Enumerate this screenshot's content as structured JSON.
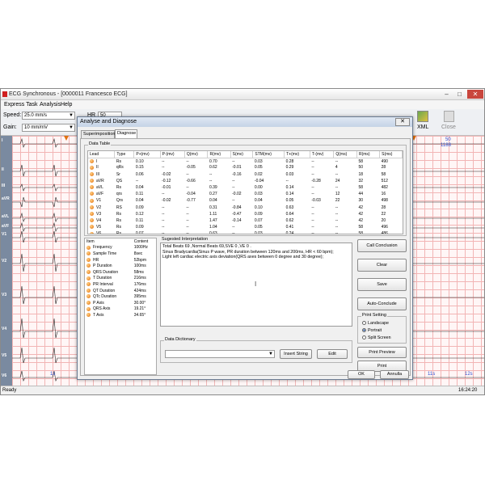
{
  "window": {
    "title": "ECG Synchronous - [0000011 Francesco ECG]"
  },
  "menu": [
    "Express Task",
    "Analysis",
    "Help"
  ],
  "toolbar": {
    "speed_label": "Speed:",
    "speed_value": "25.0 mm/s",
    "gain_label": "Gain:",
    "gain_value": "10 mm/mV",
    "hr_label": "HR",
    "hr_value": "50",
    "xml_label": "XML",
    "close_label": "Close"
  },
  "leads": [
    "I",
    "II",
    "III",
    "aVR",
    "aVL",
    "aVF",
    "V1",
    "V2",
    "V3",
    "V4",
    "V5",
    "V6"
  ],
  "topright": {
    "line1": "50",
    "line2": "1188"
  },
  "timestamps": {
    "left": "1s",
    "right1": "11s",
    "right2": "12s"
  },
  "status": {
    "left": "Ready",
    "right": "16:24:20"
  },
  "dialog": {
    "title": "Analyse and Diagnose",
    "tabs": [
      "Superimposition",
      "Diagnose"
    ],
    "data_table_label": "Data Table",
    "columns": [
      "Lead",
      "Type",
      "P+(mv)",
      "P-(mv)",
      "Q(mv)",
      "R(mv)",
      "S(mv)",
      "STM(mv)",
      "T+(mv)",
      "T-(mv)",
      "Q(ms)",
      "R(ms)",
      "S(ms)"
    ],
    "rows": [
      [
        "I",
        "Rs",
        "0.10",
        "--",
        "--",
        "0.70",
        "--",
        "0.03",
        "0.28",
        "--",
        "--",
        "58",
        "490"
      ],
      [
        "II",
        "qRs",
        "0.15",
        "--",
        "-0.05",
        "0.62",
        "-0.01",
        "0.05",
        "0.29",
        "--",
        "4",
        "50",
        "28"
      ],
      [
        "III",
        "Sr",
        "0.06",
        "-0.02",
        "--",
        "--",
        "-0.16",
        "0.02",
        "0.03",
        "--",
        "--",
        "18",
        "58"
      ],
      [
        "aVR",
        "QS",
        "--",
        "-0.12",
        "-0.66",
        "--",
        "--",
        "-0.04",
        "--",
        "-0.28",
        "24",
        "32",
        "512"
      ],
      [
        "aVL",
        "Rs",
        "0.04",
        "-0.01",
        "--",
        "0.39",
        "--",
        "0.00",
        "0.14",
        "--",
        "--",
        "58",
        "482"
      ],
      [
        "aVF",
        "qrs",
        "0.11",
        "--",
        "-0.04",
        "0.27",
        "-0.02",
        "0.03",
        "0.14",
        "--",
        "12",
        "44",
        "16"
      ],
      [
        "V1",
        "Qrs",
        "0.04",
        "-0.02",
        "-0.77",
        "0.04",
        "--",
        "0.04",
        "0.05",
        "-0.03",
        "22",
        "30",
        "498"
      ],
      [
        "V2",
        "RS",
        "0.09",
        "--",
        "--",
        "0.31",
        "-0.84",
        "0.10",
        "0.63",
        "--",
        "--",
        "42",
        "28"
      ],
      [
        "V3",
        "Rs",
        "0.12",
        "--",
        "--",
        "1.11",
        "-0.47",
        "0.09",
        "0.64",
        "--",
        "--",
        "42",
        "22"
      ],
      [
        "V4",
        "Rs",
        "0.11",
        "--",
        "--",
        "1.47",
        "-0.14",
        "0.07",
        "0.62",
        "--",
        "--",
        "42",
        "20"
      ],
      [
        "V5",
        "Rs",
        "0.09",
        "--",
        "--",
        "1.04",
        "--",
        "0.05",
        "0.41",
        "--",
        "--",
        "58",
        "496"
      ],
      [
        "V6",
        "Rs",
        "0.07",
        "--",
        "--",
        "0.63",
        "--",
        "0.03",
        "0.24",
        "--",
        "--",
        "58",
        "486"
      ]
    ],
    "item_header": [
      "Item",
      "Content"
    ],
    "items": [
      [
        "Frequency",
        "1000Hz"
      ],
      [
        "Sample Time",
        "8sec"
      ],
      [
        "HR",
        "52bpm"
      ],
      [
        "P Duration",
        "100ms"
      ],
      [
        "QRS Duration",
        "58ms"
      ],
      [
        "T Duration",
        "216ms"
      ],
      [
        "PR Interval",
        "176ms"
      ],
      [
        "QT Duration",
        "424ms"
      ],
      [
        "QTc Duration",
        "395ms"
      ],
      [
        "P Axis",
        "30.00°"
      ],
      [
        "QRS Axis",
        "19.21°"
      ],
      [
        "T Axis",
        "34.65°"
      ]
    ],
    "interp_label": "Sugested Interpretation",
    "interp_lines": [
      "Total Beats 69 ,Normal Beats 69,SVE 0 ,VE  0 .",
      "Sinus Bradycardia(Sinus P wave, PR duration between 120ms and 200ms, HR < 60 bpm);",
      "Light left cardiac electric axis deviation(QRS axes between 0 degree and 30 degree);"
    ],
    "dict_label": "Data Dictionary",
    "insert_label": "Insert String",
    "edit_label": "Edit",
    "buttons": {
      "call": "Call Conclusion",
      "clear": "Clear",
      "save": "Save",
      "auto": "Auto-Conclude"
    },
    "print_setting_label": "Print Setting",
    "landscape": "Landscape",
    "portrait": "Portrait",
    "split": "Split Screen",
    "preview": "Print Preview",
    "print": "Print",
    "ok": "OK",
    "cancel": "Annulla"
  }
}
